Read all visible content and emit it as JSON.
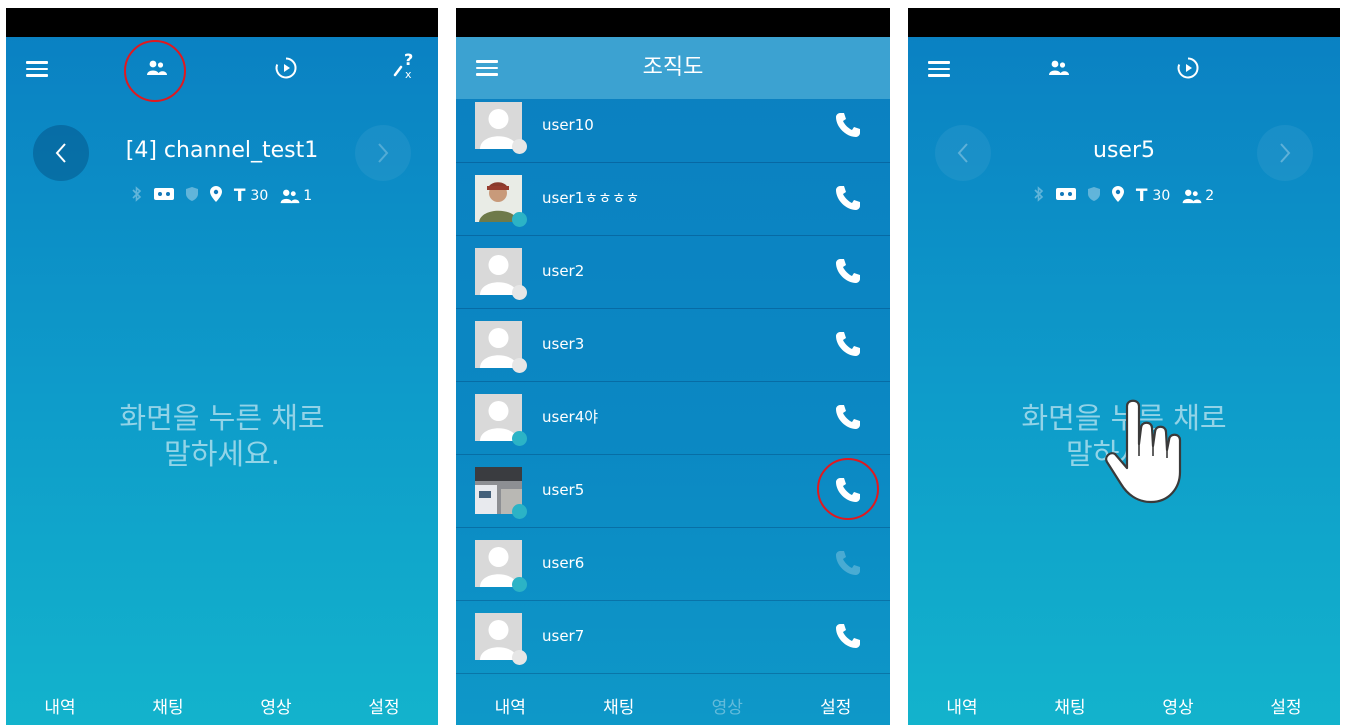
{
  "panel1": {
    "channel_title": "[4] channel_test1",
    "stat_t_value": "30",
    "stat_users_value": "1",
    "hint_line1": "화면을 누른 채로",
    "hint_line2": "말하세요.",
    "nav": [
      "내역",
      "채팅",
      "영상",
      "설정"
    ]
  },
  "panel2": {
    "header_title": "조직도",
    "users": [
      {
        "name": "user10",
        "avatar": "default",
        "status": "offline",
        "call_enabled": true
      },
      {
        "name": "user1ㅎㅎㅎㅎ",
        "avatar": "photo-soldier",
        "status": "online",
        "call_enabled": true
      },
      {
        "name": "user2",
        "avatar": "default",
        "status": "offline",
        "call_enabled": true
      },
      {
        "name": "user3",
        "avatar": "default",
        "status": "offline",
        "call_enabled": true
      },
      {
        "name": "user4야",
        "avatar": "default",
        "status": "online",
        "call_enabled": true
      },
      {
        "name": "user5",
        "avatar": "photo-room",
        "status": "online",
        "call_enabled": true,
        "highlighted": true
      },
      {
        "name": "user6",
        "avatar": "default",
        "status": "online",
        "call_enabled": false
      },
      {
        "name": "user7",
        "avatar": "default",
        "status": "offline",
        "call_enabled": true
      }
    ],
    "nav": [
      "내역",
      "채팅",
      "영상",
      "설정"
    ]
  },
  "panel3": {
    "channel_title": "user5",
    "stat_t_value": "30",
    "stat_users_value": "2",
    "hint_line1": "화면을 누른 채로",
    "hint_line2": "말하세요.",
    "nav": [
      "내역",
      "채팅",
      "영상",
      "설정"
    ]
  },
  "colors": {
    "online_dot": "#2bb3c6",
    "offline_dot": "#e6e6e6",
    "highlight_ring": "#e0191f"
  }
}
